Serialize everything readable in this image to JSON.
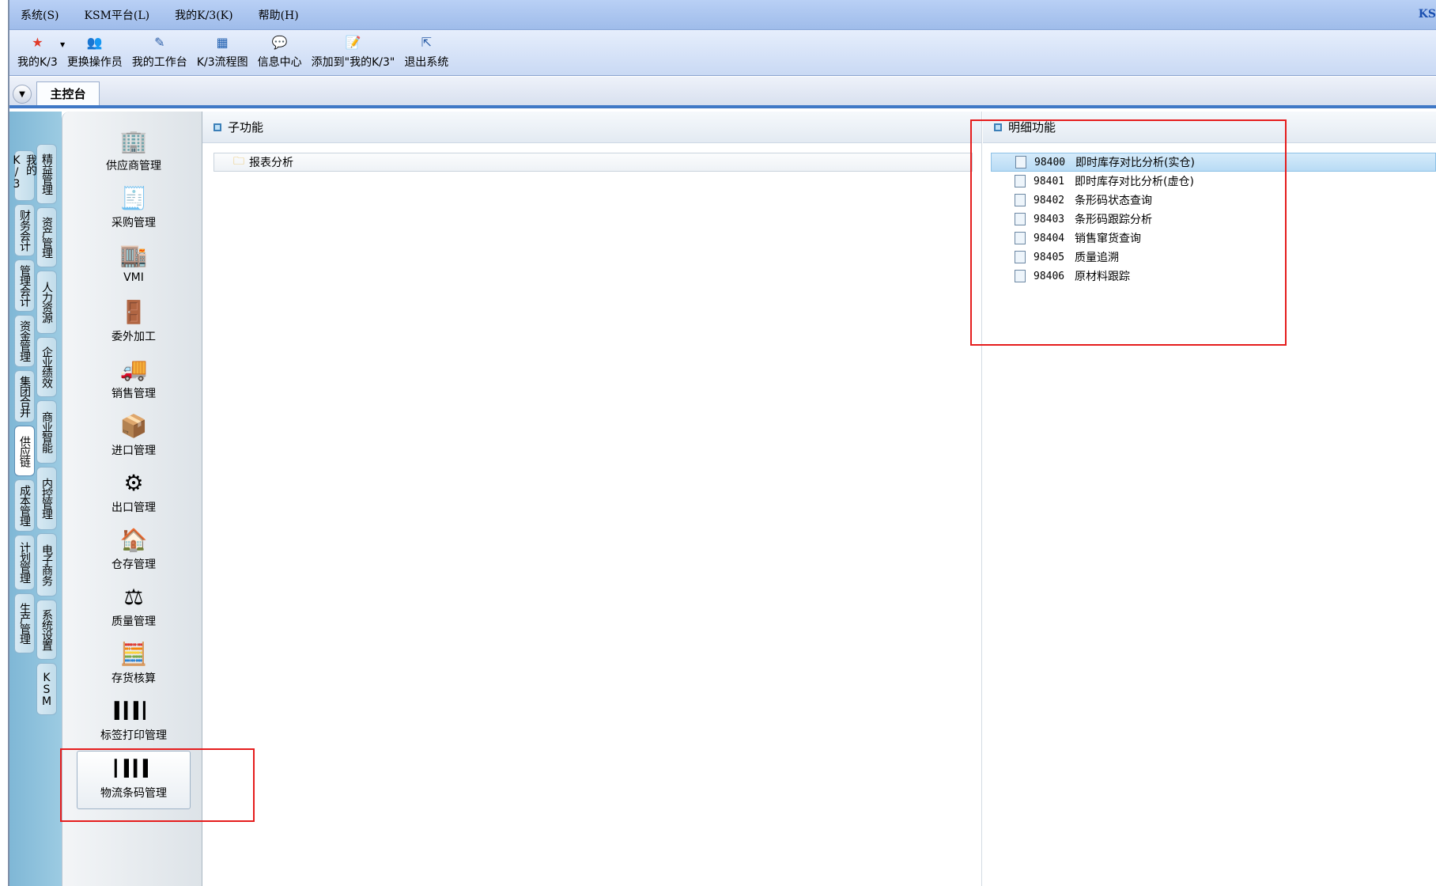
{
  "menu": {
    "items": [
      "系统(S)",
      "KSM平台(L)",
      "我的K/3(K)",
      "帮助(H)"
    ],
    "brand": "KS"
  },
  "toolbar": {
    "items": [
      {
        "label": "我的K/3",
        "icon": "star-icon"
      },
      {
        "label": "更换操作员",
        "icon": "users-icon"
      },
      {
        "label": "我的工作台",
        "icon": "pencil-icon"
      },
      {
        "label": "K/3流程图",
        "icon": "flowchart-icon"
      },
      {
        "label": "信息中心",
        "icon": "message-icon"
      },
      {
        "label": "添加到\"我的K/3\"",
        "icon": "add-note-icon"
      },
      {
        "label": "退出系统",
        "icon": "exit-icon"
      }
    ]
  },
  "tabs": {
    "active": "主控台"
  },
  "nav": {
    "col1": [
      {
        "label": "我的K/3",
        "active": false
      },
      {
        "label": "财务会计",
        "active": false
      },
      {
        "label": "管理会计",
        "active": false
      },
      {
        "label": "资金管理",
        "active": false
      },
      {
        "label": "集团合并",
        "active": false
      },
      {
        "label": "供应链",
        "active": true
      },
      {
        "label": "成本管理",
        "active": false
      },
      {
        "label": "计划管理",
        "active": false
      },
      {
        "label": "生产管理",
        "active": false
      }
    ],
    "col2": [
      {
        "label": "精益管理"
      },
      {
        "label": "资产管理"
      },
      {
        "label": "人力资源"
      },
      {
        "label": "企业绩效"
      },
      {
        "label": "商业智能"
      },
      {
        "label": "内控管理"
      },
      {
        "label": "电子商务"
      },
      {
        "label": "系统设置"
      },
      {
        "label": "KSM"
      }
    ]
  },
  "modules": [
    {
      "label": "供应商管理",
      "icon": "supplier-icon"
    },
    {
      "label": "采购管理",
      "icon": "purchase-icon"
    },
    {
      "label": "VMI",
      "icon": "vmi-icon"
    },
    {
      "label": "委外加工",
      "icon": "outsourcing-icon"
    },
    {
      "label": "销售管理",
      "icon": "sales-truck-icon"
    },
    {
      "label": "进口管理",
      "icon": "import-icon"
    },
    {
      "label": "出口管理",
      "icon": "export-icon"
    },
    {
      "label": "仓存管理",
      "icon": "warehouse-icon"
    },
    {
      "label": "质量管理",
      "icon": "scale-icon"
    },
    {
      "label": "存货核算",
      "icon": "calculator-icon"
    },
    {
      "label": "标签打印管理",
      "icon": "barcode-icon"
    },
    {
      "label": "物流条码管理",
      "icon": "barcode-scanner-icon",
      "selected": true
    }
  ],
  "sub_panel": {
    "title": "子功能",
    "folder": "报表分析"
  },
  "detail_panel": {
    "title": "明细功能",
    "items": [
      {
        "code": "98400",
        "label": "即时库存对比分析(实仓)",
        "selected": true
      },
      {
        "code": "98401",
        "label": "即时库存对比分析(虚仓)"
      },
      {
        "code": "98402",
        "label": "条形码状态查询"
      },
      {
        "code": "98403",
        "label": "条形码跟踪分析"
      },
      {
        "code": "98404",
        "label": "销售窜货查询"
      },
      {
        "code": "98405",
        "label": "质量追溯"
      },
      {
        "code": "98406",
        "label": "原材料跟踪"
      }
    ]
  }
}
